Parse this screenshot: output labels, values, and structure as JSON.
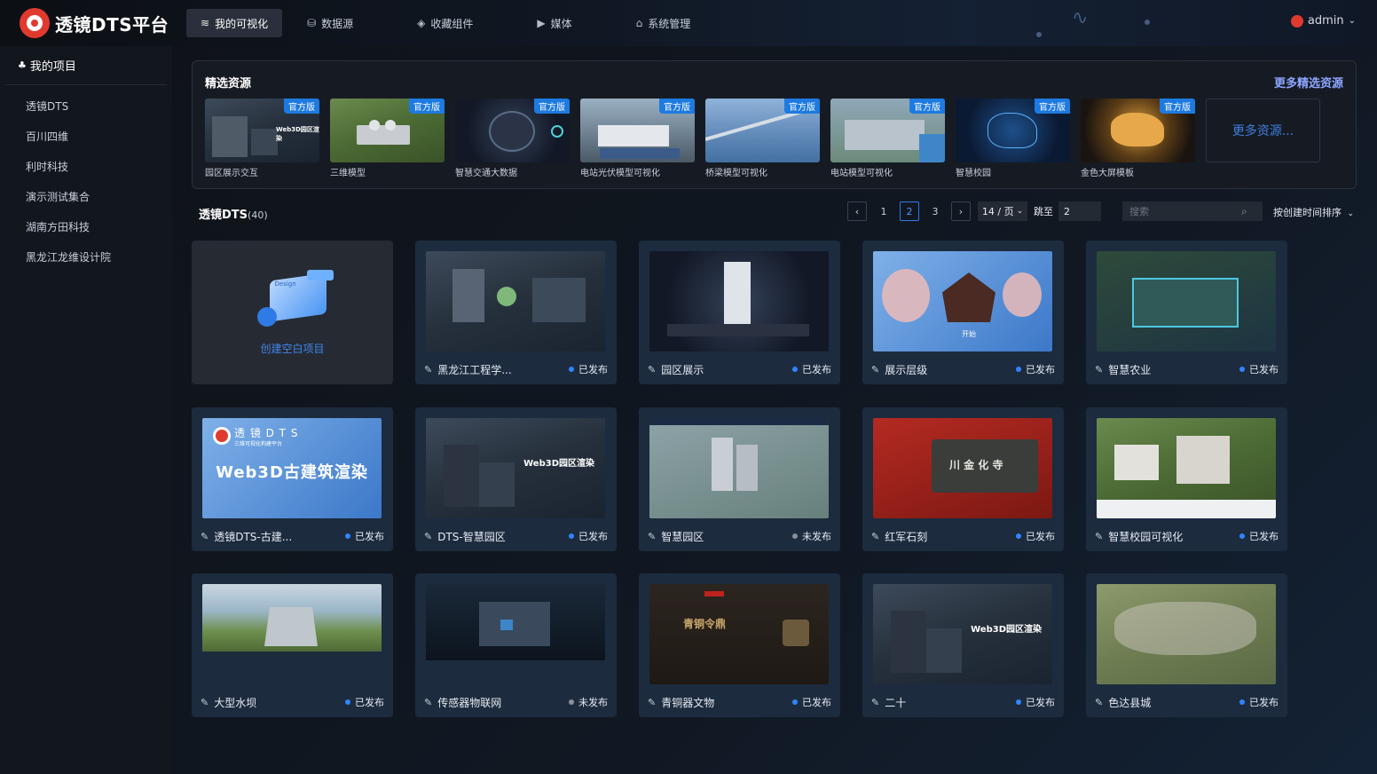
{
  "app": {
    "title": "透镜DTS平台",
    "user": "admin"
  },
  "nav": [
    {
      "label": "我的可视化",
      "icon": "layers-icon",
      "active": true
    },
    {
      "label": "数据源",
      "icon": "database-icon",
      "active": false
    },
    {
      "label": "收藏组件",
      "icon": "component-icon",
      "active": false
    },
    {
      "label": "媒体",
      "icon": "media-icon",
      "active": false
    },
    {
      "label": "系统管理",
      "icon": "admin-icon",
      "active": false
    }
  ],
  "sidebar": {
    "header": "我的项目",
    "items": [
      "透镜DTS",
      "百川四维",
      "利时科技",
      "演示测试集合",
      "湖南方田科技",
      "黑龙江龙维设计院"
    ]
  },
  "featured": {
    "title": "精选资源",
    "more_link": "更多精选资源",
    "badge": "官方版",
    "more_box": "更多资源...",
    "items": [
      {
        "label": "园区展示交互",
        "thumb_text": "Web3D园区渲染"
      },
      {
        "label": "三维模型"
      },
      {
        "label": "智慧交通大数据"
      },
      {
        "label": "电站光伏模型可视化"
      },
      {
        "label": "桥梁模型可视化"
      },
      {
        "label": "电站模型可视化"
      },
      {
        "label": "智慧校园"
      },
      {
        "label": "金色大屏模板"
      }
    ]
  },
  "projects": {
    "title": "透镜DTS",
    "count": "(40)",
    "pager": {
      "prev": "‹",
      "next": "›",
      "pages": [
        "1",
        "2",
        "3"
      ],
      "current": "2",
      "page_size": "14 / 页",
      "jump_label": "跳至",
      "jump_value": "2"
    },
    "search_placeholder": "搜索",
    "sort": "按创建时间排序",
    "create_label": "创建空白项目",
    "create_panel_text": "Design",
    "cards": [
      {
        "name": "黑龙江工程学...",
        "status": "已发布"
      },
      {
        "name": "园区展示",
        "status": "已发布"
      },
      {
        "name": "展示层级",
        "status": "已发布",
        "thumb_text": "开始"
      },
      {
        "name": "智慧农业",
        "status": "已发布"
      },
      {
        "name": "透镜DTS-古建...",
        "status": "已发布",
        "thumb_text": "Web3D古建筑渲染",
        "brand_text": "透 镜 D T S",
        "brand_sub": "三维可视化构建平台"
      },
      {
        "name": "DTS-智慧园区",
        "status": "已发布",
        "thumb_text": "Web3D园区渲染"
      },
      {
        "name": "智慧园区",
        "status": "未发布"
      },
      {
        "name": "红军石刻",
        "status": "已发布",
        "thumb_text": "川 金 化 寺"
      },
      {
        "name": "智慧校园可视化",
        "status": "已发布"
      },
      {
        "name": "大型水坝",
        "status": "已发布"
      },
      {
        "name": "传感器物联网",
        "status": "未发布"
      },
      {
        "name": "青铜器文物",
        "status": "已发布",
        "thumb_text": "青铜令鼎"
      },
      {
        "name": "二十",
        "status": "已发布",
        "thumb_text": "Web3D园区渲染"
      },
      {
        "name": "色达县城",
        "status": "已发布"
      }
    ]
  },
  "colors": {
    "accent": "#2f7be6",
    "published": "#2f86ff",
    "unpublished": "#8a909a",
    "brand_red": "#e03a2f"
  }
}
